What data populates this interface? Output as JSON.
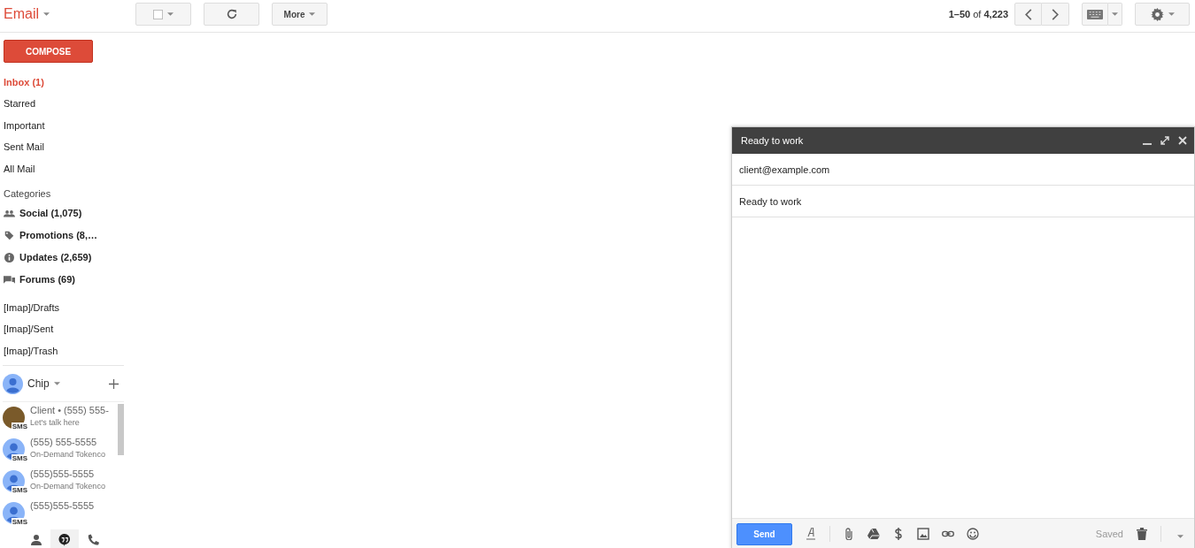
{
  "app": {
    "title": "Email"
  },
  "toolbar": {
    "more": "More",
    "pagination": "**1–50** of **4,223**"
  },
  "compose_button": "COMPOSE",
  "nav": [
    {
      "label": "Inbox (1)",
      "selected": true
    },
    {
      "label": "Starred",
      "selected": false
    },
    {
      "label": "Important",
      "selected": false
    },
    {
      "label": "Sent Mail",
      "selected": false
    },
    {
      "label": "All Mail",
      "selected": false
    }
  ],
  "categories": {
    "heading": "Categories",
    "items": [
      {
        "kind": "social",
        "label": "Social (1,075)"
      },
      {
        "kind": "promotions",
        "label": "Promotions (8,…"
      },
      {
        "kind": "updates",
        "label": "Updates (2,659)"
      },
      {
        "kind": "forums",
        "label": "Forums (69)"
      }
    ]
  },
  "labels": [
    "[Imap]/Drafts",
    "[Imap]/Sent",
    "[Imap]/Trash"
  ],
  "chat": {
    "user": "Chip",
    "contacts": [
      {
        "kind": "photo",
        "name": "Client • (555) 555-",
        "subtitle": "Let's talk here",
        "badge": "SMS"
      },
      {
        "kind": "default",
        "name": "(555) 555-5555",
        "subtitle": "On-Demand Tokenco",
        "badge": "SMS"
      },
      {
        "kind": "default",
        "name": "(555)555-5555",
        "subtitle": "On-Demand Tokenco",
        "badge": "SMS"
      },
      {
        "kind": "default",
        "name": "(555)555-5555",
        "badge": "SMS"
      }
    ],
    "tabs": [
      {
        "kind": "contacts",
        "selected": false
      },
      {
        "kind": "hangouts",
        "selected": true
      },
      {
        "kind": "phone",
        "selected": false
      }
    ]
  },
  "compose": {
    "title": "Ready to work",
    "to": "client@example.com",
    "subject": "Ready to work",
    "send": "Send",
    "status": "Saved"
  }
}
